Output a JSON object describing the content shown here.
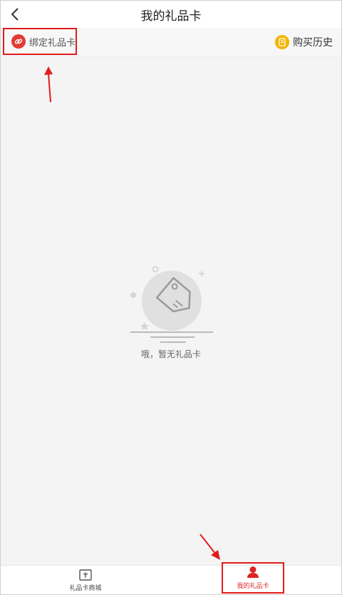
{
  "header": {
    "title": "我的礼品卡",
    "back_icon": "chevron-left-icon"
  },
  "toolbar": {
    "bind_label": "绑定礼品卡",
    "bind_icon": "link-icon",
    "history_label": "购买历史",
    "history_icon": "receipt-icon"
  },
  "empty_state": {
    "icon": "tag-icon",
    "message": "哦，暂无礼品卡"
  },
  "tabs": [
    {
      "label": "礼品卡商城",
      "icon": "gift-card-icon",
      "active": false
    },
    {
      "label": "我的礼品卡",
      "icon": "user-icon",
      "active": true
    }
  ],
  "colors": {
    "accent": "#e02424",
    "highlight_border": "#e31b1b",
    "history_icon": "#f5b400",
    "bind_icon": "#e23b36"
  }
}
